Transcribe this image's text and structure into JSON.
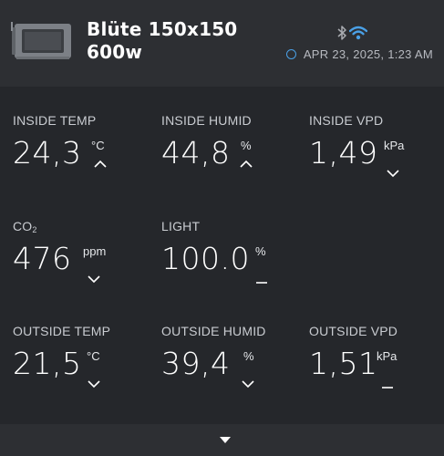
{
  "header": {
    "title_line1": "Blüte 150x150",
    "title_line2": "600w",
    "timestamp": "APR 23, 2025, 1:23 AM",
    "icons": [
      "device-thumbnail",
      "bluetooth-icon",
      "wifi-icon",
      "status-ring-icon"
    ]
  },
  "metrics": {
    "inside_temp": {
      "label": "INSIDE TEMP",
      "value": "24,3",
      "unit": "°C",
      "trend": "up"
    },
    "inside_humid": {
      "label": "INSIDE HUMID",
      "value": "44,8",
      "unit": "%",
      "trend": "up"
    },
    "inside_vpd": {
      "label": "INSIDE VPD",
      "value": "1,49",
      "unit": "kPa",
      "trend": "down"
    },
    "co2": {
      "label": "CO",
      "label_sub": "2",
      "value": "476",
      "unit": "ppm",
      "trend": "down"
    },
    "light": {
      "label": "LIGHT",
      "value": "100.0",
      "unit": "%",
      "trend": "flat"
    },
    "outside_temp": {
      "label": "OUTSIDE TEMP",
      "value": "21,5",
      "unit": "°C",
      "trend": "down"
    },
    "outside_humid": {
      "label": "OUTSIDE HUMID",
      "value": "39,4",
      "unit": "%",
      "trend": "down"
    },
    "outside_vpd": {
      "label": "OUTSIDE VPD",
      "value": "1,51",
      "unit": "kPa",
      "trend": "flat"
    }
  },
  "colors": {
    "background": "#25272b",
    "panel": "#2d2f33",
    "accent": "#4aa0e6"
  }
}
